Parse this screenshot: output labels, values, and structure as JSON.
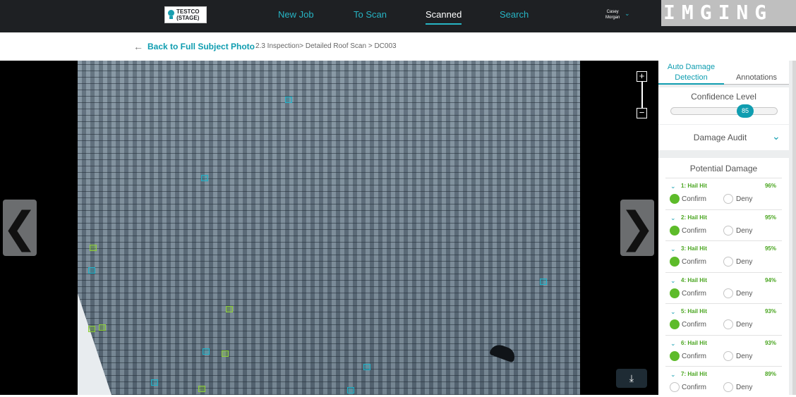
{
  "header": {
    "logo_line1": "TESTCO",
    "logo_line2": "(STAGE)",
    "nav": [
      {
        "label": "New Job"
      },
      {
        "label": "To Scan"
      },
      {
        "label": "Scanned"
      },
      {
        "label": "Search"
      }
    ],
    "active_nav": "Scanned",
    "user_first": "Casey",
    "user_last": "Morgan",
    "brand": "IMGING"
  },
  "crumbs": {
    "back_label": "Back to Full Subject Photo",
    "path": "2.3 Inspection> Detailed Roof Scan > DC003"
  },
  "viewer": {
    "prev_icon": "chevron-left",
    "next_icon": "chevron-right",
    "zoom_in": "+",
    "zoom_out": "−",
    "download_icon": "download"
  },
  "panel": {
    "tab_auto_line1": "Auto Damage",
    "tab_auto_line2": "Detection",
    "tab_annotations": "Annotations",
    "confidence_label": "Confidence Level",
    "confidence_value": "85",
    "damage_audit": "Damage Audit",
    "potential_damage": "Potential Damage",
    "items": [
      {
        "name": "1: Hail Hit",
        "pct": "96%",
        "confirm": "Confirm",
        "deny": "Deny",
        "confirmed": true
      },
      {
        "name": "2: Hail Hit",
        "pct": "95%",
        "confirm": "Confirm",
        "deny": "Deny",
        "confirmed": true
      },
      {
        "name": "3: Hail Hit",
        "pct": "95%",
        "confirm": "Confirm",
        "deny": "Deny",
        "confirmed": true
      },
      {
        "name": "4: Hail Hit",
        "pct": "94%",
        "confirm": "Confirm",
        "deny": "Deny",
        "confirmed": true
      },
      {
        "name": "5: Hail Hit",
        "pct": "93%",
        "confirm": "Confirm",
        "deny": "Deny",
        "confirmed": true
      },
      {
        "name": "6: Hail Hit",
        "pct": "93%",
        "confirm": "Confirm",
        "deny": "Deny",
        "confirmed": true
      },
      {
        "name": "7: Hail Hit",
        "pct": "89%",
        "confirm": "Confirm",
        "deny": "Deny",
        "confirmed": false
      }
    ]
  },
  "colors": {
    "accent": "#0f9db0",
    "nav_link": "#27b4c4",
    "confirm_green": "#5dbb2a",
    "hit_green": "#49a51f",
    "header_bg": "#1e2023"
  }
}
